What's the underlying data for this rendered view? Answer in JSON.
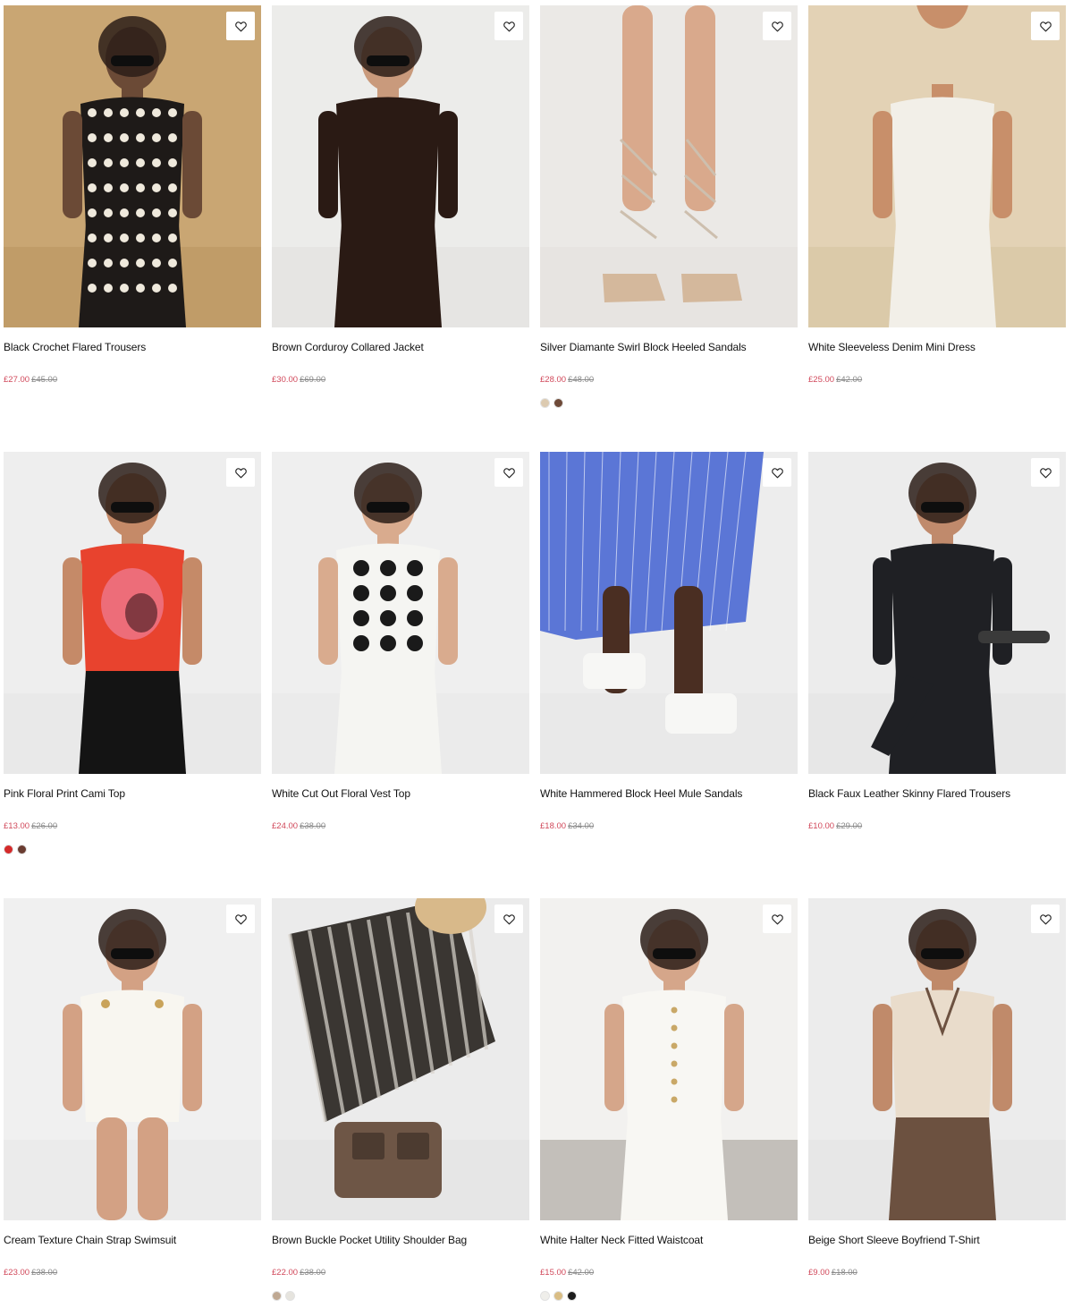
{
  "colors": {
    "sale_price": "#d1495b",
    "original_price": "#8a8a8a",
    "title": "#111111",
    "background": "#ffffff"
  },
  "icons": {
    "wishlist": "heart-outline-icon"
  },
  "products": [
    {
      "title": "Black Crochet Flared Trousers",
      "price": "£27.00",
      "was_price": "£45.00",
      "swatches": [],
      "image_theme": {
        "bg": "#c9a673",
        "floor": "#b8945f",
        "garment": "#1e1a18",
        "accent": "#efe9dc",
        "skin": "#6b4a36"
      }
    },
    {
      "title": "Brown Corduroy Collared Jacket",
      "price": "£30.00",
      "was_price": "£69.00",
      "swatches": [],
      "image_theme": {
        "bg": "#ececea",
        "floor": "#e2e0dc",
        "garment": "#2a1a14",
        "accent": "#d9d6cf",
        "skin": "#c99a7c"
      }
    },
    {
      "title": "Silver Diamante Swirl Block Heeled Sandals",
      "price": "£28.00",
      "was_price": "£48.00",
      "swatches": [
        "#dccab0",
        "#6e4a38"
      ],
      "image_theme": {
        "bg": "#ebe9e6",
        "floor": "#e3e0dc",
        "garment": "#cdbfae",
        "accent": "#d4b89c",
        "skin": "#d9a98c"
      }
    },
    {
      "title": "White Sleeveless Denim Mini Dress",
      "price": "£25.00",
      "was_price": "£42.00",
      "swatches": [],
      "image_theme": {
        "bg": "#e3d2b5",
        "floor": "#d6c29f",
        "garment": "#f2efe8",
        "accent": "#2a1f1a",
        "skin": "#c88f6a"
      }
    },
    {
      "title": "Pink Floral Print Cami Top",
      "price": "£13.00",
      "was_price": "£26.00",
      "swatches": [
        "#d42a2a",
        "#6a3c31"
      ],
      "image_theme": {
        "bg": "#eeeeee",
        "floor": "#e6e6e6",
        "garment": "#e8432e",
        "accent": "#151515",
        "skin": "#c58a68"
      }
    },
    {
      "title": "White Cut Out Floral Vest Top",
      "price": "£24.00",
      "was_price": "£38.00",
      "swatches": [],
      "image_theme": {
        "bg": "#efefef",
        "floor": "#e7e7e7",
        "garment": "#f5f5f2",
        "accent": "#1a1a1a",
        "skin": "#d9ab8e"
      }
    },
    {
      "title": "White Hammered Block Heel Mule Sandals",
      "price": "£18.00",
      "was_price": "£34.00",
      "swatches": [],
      "image_theme": {
        "bg": "#ededed",
        "floor": "#e6e6e6",
        "garment": "#5b76d6",
        "accent": "#f7f7f5",
        "skin": "#4a2e22"
      }
    },
    {
      "title": "Black Faux Leather Skinny Flared Trousers",
      "price": "£10.00",
      "was_price": "£29.00",
      "swatches": [],
      "image_theme": {
        "bg": "#ececec",
        "floor": "#e4e4e4",
        "garment": "#1f2024",
        "accent": "#8f8878",
        "skin": "#c08a6c"
      }
    },
    {
      "title": "Cream Texture Chain Strap Swimsuit",
      "price": "£23.00",
      "was_price": "£38.00",
      "swatches": [],
      "image_theme": {
        "bg": "#f0f0f0",
        "floor": "#e8e8e8",
        "garment": "#f8f6f0",
        "accent": "#c9a35a",
        "skin": "#d3a184"
      }
    },
    {
      "title": "Brown Buckle Pocket Utility Shoulder Bag",
      "price": "£22.00",
      "was_price": "£38.00",
      "swatches": [
        "#bfa892",
        "#e6e4de"
      ],
      "image_theme": {
        "bg": "#ebebeb",
        "floor": "#e2e2e2",
        "garment": "#3a3632",
        "accent": "#6e5646",
        "skin": "#e3b99d"
      }
    },
    {
      "title": "White Halter Neck Fitted Waistcoat",
      "price": "£15.00",
      "was_price": "£42.00",
      "swatches": [
        "#efeeea",
        "#d9bd84",
        "#1c1c1c"
      ],
      "image_theme": {
        "bg": "#f2f1ef",
        "floor": "#9c968e",
        "garment": "#f8f7f3",
        "accent": "#c9a867",
        "skin": "#d5a68a"
      }
    },
    {
      "title": "Beige Short Sleeve Boyfriend T-Shirt",
      "price": "£9.00",
      "was_price": "£18.00",
      "swatches": [],
      "image_theme": {
        "bg": "#ececec",
        "floor": "#e4e4e4",
        "garment": "#e9dccb",
        "accent": "#6c5140",
        "skin": "#c08a6a"
      }
    }
  ]
}
